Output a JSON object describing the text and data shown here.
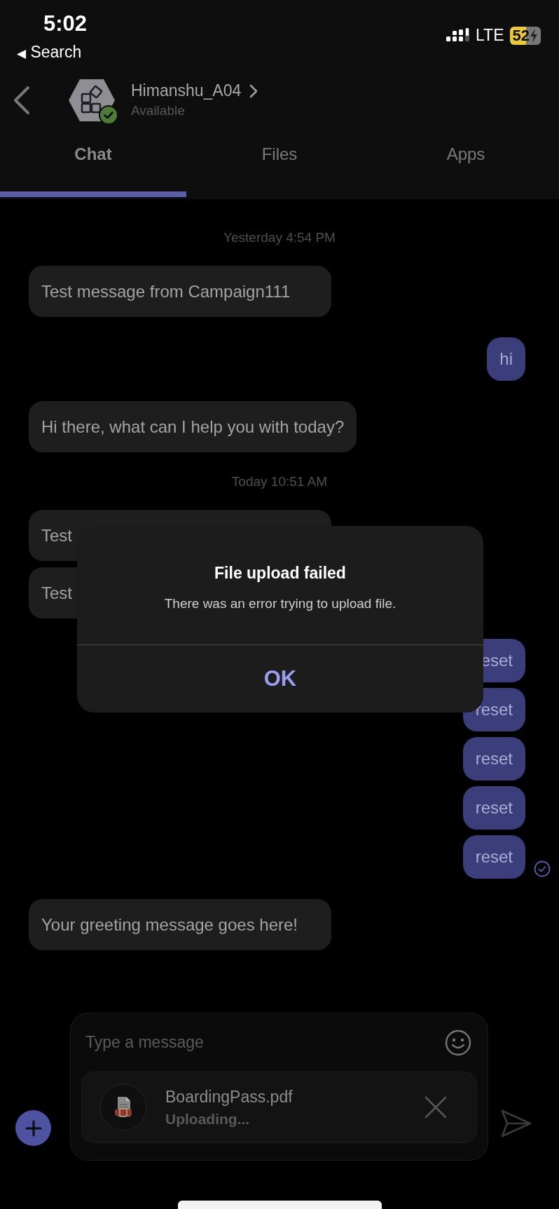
{
  "status_bar": {
    "time": "5:02",
    "back_label": "Search",
    "back_glyph": "◀",
    "network": "LTE",
    "battery": "52"
  },
  "header": {
    "name": "Himanshu_A04",
    "presence": "Available",
    "available": true
  },
  "tabs": [
    {
      "label": "Chat",
      "selected": true
    },
    {
      "label": "Files",
      "selected": false
    },
    {
      "label": "Apps",
      "selected": false
    }
  ],
  "chat": [
    {
      "kind": "timestamp",
      "text": "Yesterday 4:54 PM"
    },
    {
      "kind": "incoming",
      "text": "Test message from Campaign111"
    },
    {
      "kind": "outgoing",
      "text": "hi",
      "read": false
    },
    {
      "kind": "incoming",
      "text": "Hi there, what can I help you with today?"
    },
    {
      "kind": "timestamp",
      "text": "Today 10:51 AM"
    },
    {
      "kind": "incoming",
      "text": "Test"
    },
    {
      "kind": "incoming",
      "text": "Test"
    },
    {
      "kind": "outgoing",
      "text": "eset",
      "read": false
    },
    {
      "kind": "outgoing",
      "text": "reset",
      "read": false
    },
    {
      "kind": "outgoing",
      "text": "reset",
      "read": false
    },
    {
      "kind": "outgoing",
      "text": "reset",
      "read": false
    },
    {
      "kind": "outgoing",
      "text": "reset",
      "read": true
    },
    {
      "kind": "incoming",
      "text": "Your greeting message goes here!"
    }
  ],
  "dialog": {
    "title": "File upload failed",
    "message": "There was an error trying to upload file.",
    "button": "OK"
  },
  "composer": {
    "placeholder": "Type a message",
    "attachment": {
      "file_name": "BoardingPass.pdf",
      "status": "Uploading..."
    }
  }
}
